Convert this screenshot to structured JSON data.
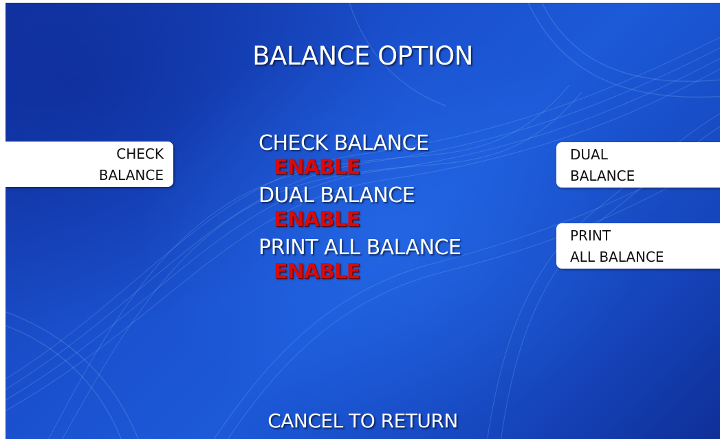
{
  "screen": {
    "title": "BALANCE OPTION",
    "footer": "CANCEL TO RETURN"
  },
  "options": [
    {
      "label": "CHECK BALANCE",
      "status": "ENABLE"
    },
    {
      "label": "DUAL BALANCE",
      "status": "ENABLE"
    },
    {
      "label": "PRINT ALL BALANCE",
      "status": "ENABLE"
    }
  ],
  "buttons": {
    "check_balance": {
      "line1": "CHECK",
      "line2": "BALANCE"
    },
    "dual_balance": {
      "line1": "DUAL",
      "line2": "BALANCE"
    },
    "print_all_balance": {
      "line1": "PRINT",
      "line2": "ALL BALANCE"
    }
  },
  "colors": {
    "background": "#1a4fcc",
    "status_text": "#d80a0a",
    "button_bg": "#ffffff"
  }
}
